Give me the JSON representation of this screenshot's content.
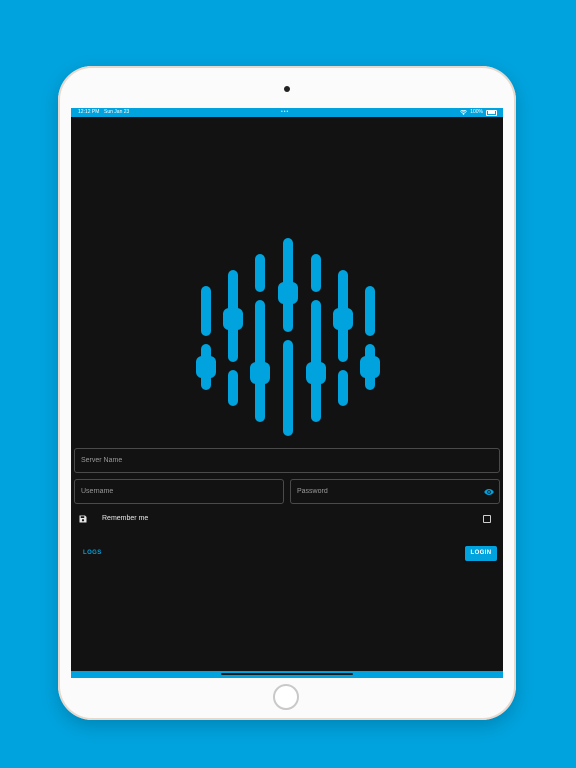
{
  "status_bar": {
    "time": "12:12 PM",
    "date": "Sun Jan 23",
    "dots": "•••",
    "battery": "100%",
    "icons": [
      "wifi-icon",
      "battery-icon"
    ]
  },
  "logo": {
    "icon": "equalizer-sphere-logo",
    "color": "#00a3de"
  },
  "form": {
    "server_placeholder": "Server Name",
    "username_placeholder": "Username",
    "password_placeholder": "Password",
    "server_value": "",
    "username_value": "",
    "password_value": "",
    "password_visibility_icon": "eye-icon",
    "remember_icon": "save-icon",
    "remember_label": "Remember me",
    "remember_checked": false
  },
  "actions": {
    "logs_label": "LOGS",
    "login_label": "LOGIN"
  },
  "colors": {
    "accent": "#00a3de",
    "background": "#121212"
  }
}
